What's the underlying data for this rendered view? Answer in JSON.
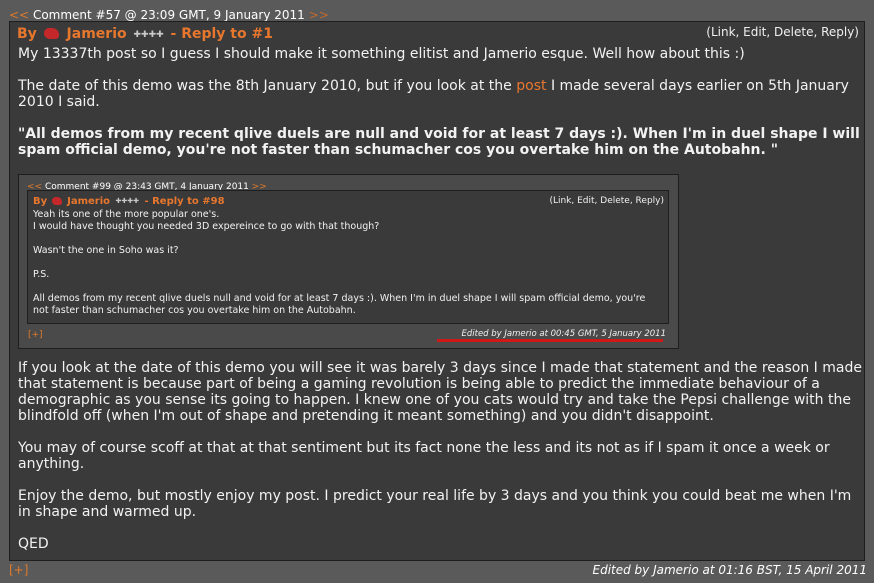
{
  "comment": {
    "nav_prev": "<<",
    "nav_title": "Comment #57 @ 23:09 GMT, 9 January 2011",
    "nav_next": ">>",
    "by_label": "By",
    "author": "Jamerio",
    "reply_label": "- Reply to #1",
    "actions": "(Link, Edit, Delete, Reply)",
    "para1": "My 13337th post so I guess I should make it something elitist and Jamerio esque. Well how about this :)",
    "para2_before": "The date of this demo was the 8th January 2010, but if you look at the ",
    "para2_link": "post",
    "para2_after": " I made several days earlier on 5th January 2010 I said.",
    "quote": "\"All demos from my recent qlive duels are null and void for at least 7 days :). When I'm in duel shape I will spam official demo, you're not faster than schumacher cos you overtake him on the Autobahn. \"",
    "para3": "If you look at the date of this demo you will see it was barely 3 days since I made that statement and the reason I made that statement is because part of being a gaming revolution is being able to predict the immediate behaviour of a demographic as you sense its going to happen. I knew one of you cats would try and take the Pepsi challenge with the blindfold off (when I'm out of shape and pretending it meant something) and you didn't disappoint.",
    "para4": "You may of course scoff at that at that sentiment but its fact none the less and its not as if I spam it once a week or anything.",
    "para5": "Enjoy the demo, but mostly enjoy my post. I predict your real life by 3 days and you think you could beat me when I'm in shape and warmed up.",
    "para6": "QED",
    "expand": "[+]",
    "edited": "Edited by Jamerio at 01:16 BST, 15 April 2011"
  },
  "quoted_comment": {
    "nav_prev": "<<",
    "nav_title": "Comment #99 @ 23:43 GMT, 4 January 2011",
    "nav_next": ">>",
    "by_label": "By",
    "author": "Jamerio",
    "reply_label": "- Reply to #98",
    "actions": "(Link, Edit, Delete, Reply)",
    "line1": "Yeah its one of the more popular one's.",
    "line2": "I would have thought you needed 3D expereince to go with that though?",
    "line3": "Wasn't the one in Soho was it?",
    "line4": "P.S.",
    "line5": "All demos from my recent qlive duels null and void for at least 7 days :). When I'm in duel shape I will spam official demo, you're not faster than schumacher cos you overtake him on the Autobahn.",
    "expand": "[+]",
    "edited": "Edited by Jamerio at 00:45 GMT, 5 January 2011"
  },
  "icons": {
    "user_badge": "red-helmet-icon",
    "rank": "rank-stars-icon"
  },
  "colors": {
    "accent": "#e8772e",
    "background": "#5a5a5a",
    "panel": "#3a3a3a",
    "underline": "#d01818"
  }
}
